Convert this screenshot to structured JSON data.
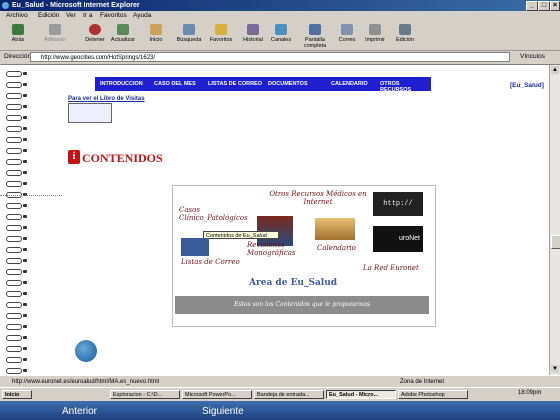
{
  "window": {
    "title": "Eu_Salud - Microsoft Internet Explorer"
  },
  "menu": [
    "Archivo",
    "Edición",
    "Ver",
    "Ir a",
    "Favoritos",
    "Ayuda"
  ],
  "toolbar": [
    {
      "label": "Atrás",
      "icon": "back-arrow-icon"
    },
    {
      "label": "Adelante",
      "icon": "forward-arrow-icon"
    },
    {
      "label": "Detener",
      "icon": "stop-icon"
    },
    {
      "label": "Actualizar",
      "icon": "refresh-icon"
    },
    {
      "label": "Inicio",
      "icon": "home-icon"
    },
    {
      "label": "Búsqueda",
      "icon": "search-icon"
    },
    {
      "label": "Favoritos",
      "icon": "favorites-icon"
    },
    {
      "label": "Historial",
      "icon": "history-icon"
    },
    {
      "label": "Canales",
      "icon": "channels-icon"
    },
    {
      "label": "Pantalla completa",
      "icon": "fullscreen-icon"
    },
    {
      "label": "Correo",
      "icon": "mail-icon"
    },
    {
      "label": "Imprimir",
      "icon": "print-icon"
    },
    {
      "label": "Edición",
      "icon": "edit-icon"
    }
  ],
  "address": {
    "label": "Dirección",
    "value": "http://www.geocities.com/HotSprings/1623/",
    "go_label": "Vínculos"
  },
  "site": {
    "nav": [
      "INTRODUCCION",
      "CASO DEL MES",
      "LISTAS DE CORREO",
      "DOCUMENTOS",
      "CALENDARIO",
      "OTROS RECURSOS"
    ],
    "brand": "[Eu_Salud]",
    "guestbook_link": "Para ver el Libro de Visitas",
    "contenidos_icon": "i",
    "contenidos_title": "CONTENIDOS",
    "panel": {
      "otros_recursos": "Otros Recursos Médicos en Internet",
      "casos": "Casos Clínico_Patológicos",
      "tooltip": "Contenidos de Eu_Salud",
      "revisiones": "Revisiones Monográficas",
      "calendario": "Calendario",
      "listas": "Listas de Correo",
      "red": "La Red Euronet",
      "area_title": "Area de Eu_Salud",
      "ofrecemos": "Estos son los Contenidos que le proponemos",
      "http_logo": "http://",
      "euronet_logo": "uroNet"
    }
  },
  "status": {
    "text": "http://www.euronet.es/euroalud/html/MA.es_nuevo.html",
    "zone": "Zona de Internet"
  },
  "taskbar": {
    "start": "Inicio",
    "tasks": [
      "Exploracion - C:\\D...",
      "Microsoft PowerPo...",
      "Bandeja de entrada...",
      "Eu_Salud - Micro...",
      "Adobe Photoshop"
    ],
    "clock": "18:09pm"
  },
  "presentation": {
    "prev": "Anterior",
    "next": "Siguiente"
  }
}
